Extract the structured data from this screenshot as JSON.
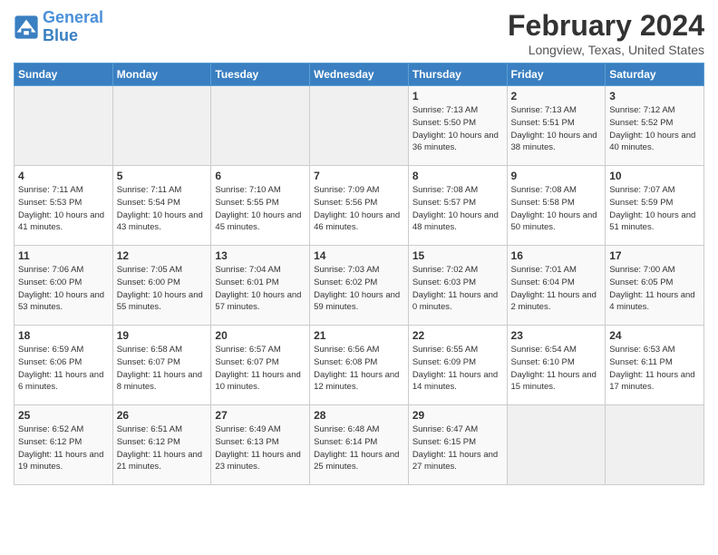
{
  "logo": {
    "line1": "General",
    "line2": "Blue"
  },
  "title": "February 2024",
  "subtitle": "Longview, Texas, United States",
  "days_of_week": [
    "Sunday",
    "Monday",
    "Tuesday",
    "Wednesday",
    "Thursday",
    "Friday",
    "Saturday"
  ],
  "weeks": [
    [
      {
        "num": "",
        "sunrise": "",
        "sunset": "",
        "daylight": "",
        "empty": true
      },
      {
        "num": "",
        "sunrise": "",
        "sunset": "",
        "daylight": "",
        "empty": true
      },
      {
        "num": "",
        "sunrise": "",
        "sunset": "",
        "daylight": "",
        "empty": true
      },
      {
        "num": "",
        "sunrise": "",
        "sunset": "",
        "daylight": "",
        "empty": true
      },
      {
        "num": "1",
        "sunrise": "Sunrise: 7:13 AM",
        "sunset": "Sunset: 5:50 PM",
        "daylight": "Daylight: 10 hours and 36 minutes."
      },
      {
        "num": "2",
        "sunrise": "Sunrise: 7:13 AM",
        "sunset": "Sunset: 5:51 PM",
        "daylight": "Daylight: 10 hours and 38 minutes."
      },
      {
        "num": "3",
        "sunrise": "Sunrise: 7:12 AM",
        "sunset": "Sunset: 5:52 PM",
        "daylight": "Daylight: 10 hours and 40 minutes."
      }
    ],
    [
      {
        "num": "4",
        "sunrise": "Sunrise: 7:11 AM",
        "sunset": "Sunset: 5:53 PM",
        "daylight": "Daylight: 10 hours and 41 minutes."
      },
      {
        "num": "5",
        "sunrise": "Sunrise: 7:11 AM",
        "sunset": "Sunset: 5:54 PM",
        "daylight": "Daylight: 10 hours and 43 minutes."
      },
      {
        "num": "6",
        "sunrise": "Sunrise: 7:10 AM",
        "sunset": "Sunset: 5:55 PM",
        "daylight": "Daylight: 10 hours and 45 minutes."
      },
      {
        "num": "7",
        "sunrise": "Sunrise: 7:09 AM",
        "sunset": "Sunset: 5:56 PM",
        "daylight": "Daylight: 10 hours and 46 minutes."
      },
      {
        "num": "8",
        "sunrise": "Sunrise: 7:08 AM",
        "sunset": "Sunset: 5:57 PM",
        "daylight": "Daylight: 10 hours and 48 minutes."
      },
      {
        "num": "9",
        "sunrise": "Sunrise: 7:08 AM",
        "sunset": "Sunset: 5:58 PM",
        "daylight": "Daylight: 10 hours and 50 minutes."
      },
      {
        "num": "10",
        "sunrise": "Sunrise: 7:07 AM",
        "sunset": "Sunset: 5:59 PM",
        "daylight": "Daylight: 10 hours and 51 minutes."
      }
    ],
    [
      {
        "num": "11",
        "sunrise": "Sunrise: 7:06 AM",
        "sunset": "Sunset: 6:00 PM",
        "daylight": "Daylight: 10 hours and 53 minutes."
      },
      {
        "num": "12",
        "sunrise": "Sunrise: 7:05 AM",
        "sunset": "Sunset: 6:00 PM",
        "daylight": "Daylight: 10 hours and 55 minutes."
      },
      {
        "num": "13",
        "sunrise": "Sunrise: 7:04 AM",
        "sunset": "Sunset: 6:01 PM",
        "daylight": "Daylight: 10 hours and 57 minutes."
      },
      {
        "num": "14",
        "sunrise": "Sunrise: 7:03 AM",
        "sunset": "Sunset: 6:02 PM",
        "daylight": "Daylight: 10 hours and 59 minutes."
      },
      {
        "num": "15",
        "sunrise": "Sunrise: 7:02 AM",
        "sunset": "Sunset: 6:03 PM",
        "daylight": "Daylight: 11 hours and 0 minutes."
      },
      {
        "num": "16",
        "sunrise": "Sunrise: 7:01 AM",
        "sunset": "Sunset: 6:04 PM",
        "daylight": "Daylight: 11 hours and 2 minutes."
      },
      {
        "num": "17",
        "sunrise": "Sunrise: 7:00 AM",
        "sunset": "Sunset: 6:05 PM",
        "daylight": "Daylight: 11 hours and 4 minutes."
      }
    ],
    [
      {
        "num": "18",
        "sunrise": "Sunrise: 6:59 AM",
        "sunset": "Sunset: 6:06 PM",
        "daylight": "Daylight: 11 hours and 6 minutes."
      },
      {
        "num": "19",
        "sunrise": "Sunrise: 6:58 AM",
        "sunset": "Sunset: 6:07 PM",
        "daylight": "Daylight: 11 hours and 8 minutes."
      },
      {
        "num": "20",
        "sunrise": "Sunrise: 6:57 AM",
        "sunset": "Sunset: 6:07 PM",
        "daylight": "Daylight: 11 hours and 10 minutes."
      },
      {
        "num": "21",
        "sunrise": "Sunrise: 6:56 AM",
        "sunset": "Sunset: 6:08 PM",
        "daylight": "Daylight: 11 hours and 12 minutes."
      },
      {
        "num": "22",
        "sunrise": "Sunrise: 6:55 AM",
        "sunset": "Sunset: 6:09 PM",
        "daylight": "Daylight: 11 hours and 14 minutes."
      },
      {
        "num": "23",
        "sunrise": "Sunrise: 6:54 AM",
        "sunset": "Sunset: 6:10 PM",
        "daylight": "Daylight: 11 hours and 15 minutes."
      },
      {
        "num": "24",
        "sunrise": "Sunrise: 6:53 AM",
        "sunset": "Sunset: 6:11 PM",
        "daylight": "Daylight: 11 hours and 17 minutes."
      }
    ],
    [
      {
        "num": "25",
        "sunrise": "Sunrise: 6:52 AM",
        "sunset": "Sunset: 6:12 PM",
        "daylight": "Daylight: 11 hours and 19 minutes."
      },
      {
        "num": "26",
        "sunrise": "Sunrise: 6:51 AM",
        "sunset": "Sunset: 6:12 PM",
        "daylight": "Daylight: 11 hours and 21 minutes."
      },
      {
        "num": "27",
        "sunrise": "Sunrise: 6:49 AM",
        "sunset": "Sunset: 6:13 PM",
        "daylight": "Daylight: 11 hours and 23 minutes."
      },
      {
        "num": "28",
        "sunrise": "Sunrise: 6:48 AM",
        "sunset": "Sunset: 6:14 PM",
        "daylight": "Daylight: 11 hours and 25 minutes."
      },
      {
        "num": "29",
        "sunrise": "Sunrise: 6:47 AM",
        "sunset": "Sunset: 6:15 PM",
        "daylight": "Daylight: 11 hours and 27 minutes."
      },
      {
        "num": "",
        "sunrise": "",
        "sunset": "",
        "daylight": "",
        "empty": true
      },
      {
        "num": "",
        "sunrise": "",
        "sunset": "",
        "daylight": "",
        "empty": true
      }
    ]
  ]
}
